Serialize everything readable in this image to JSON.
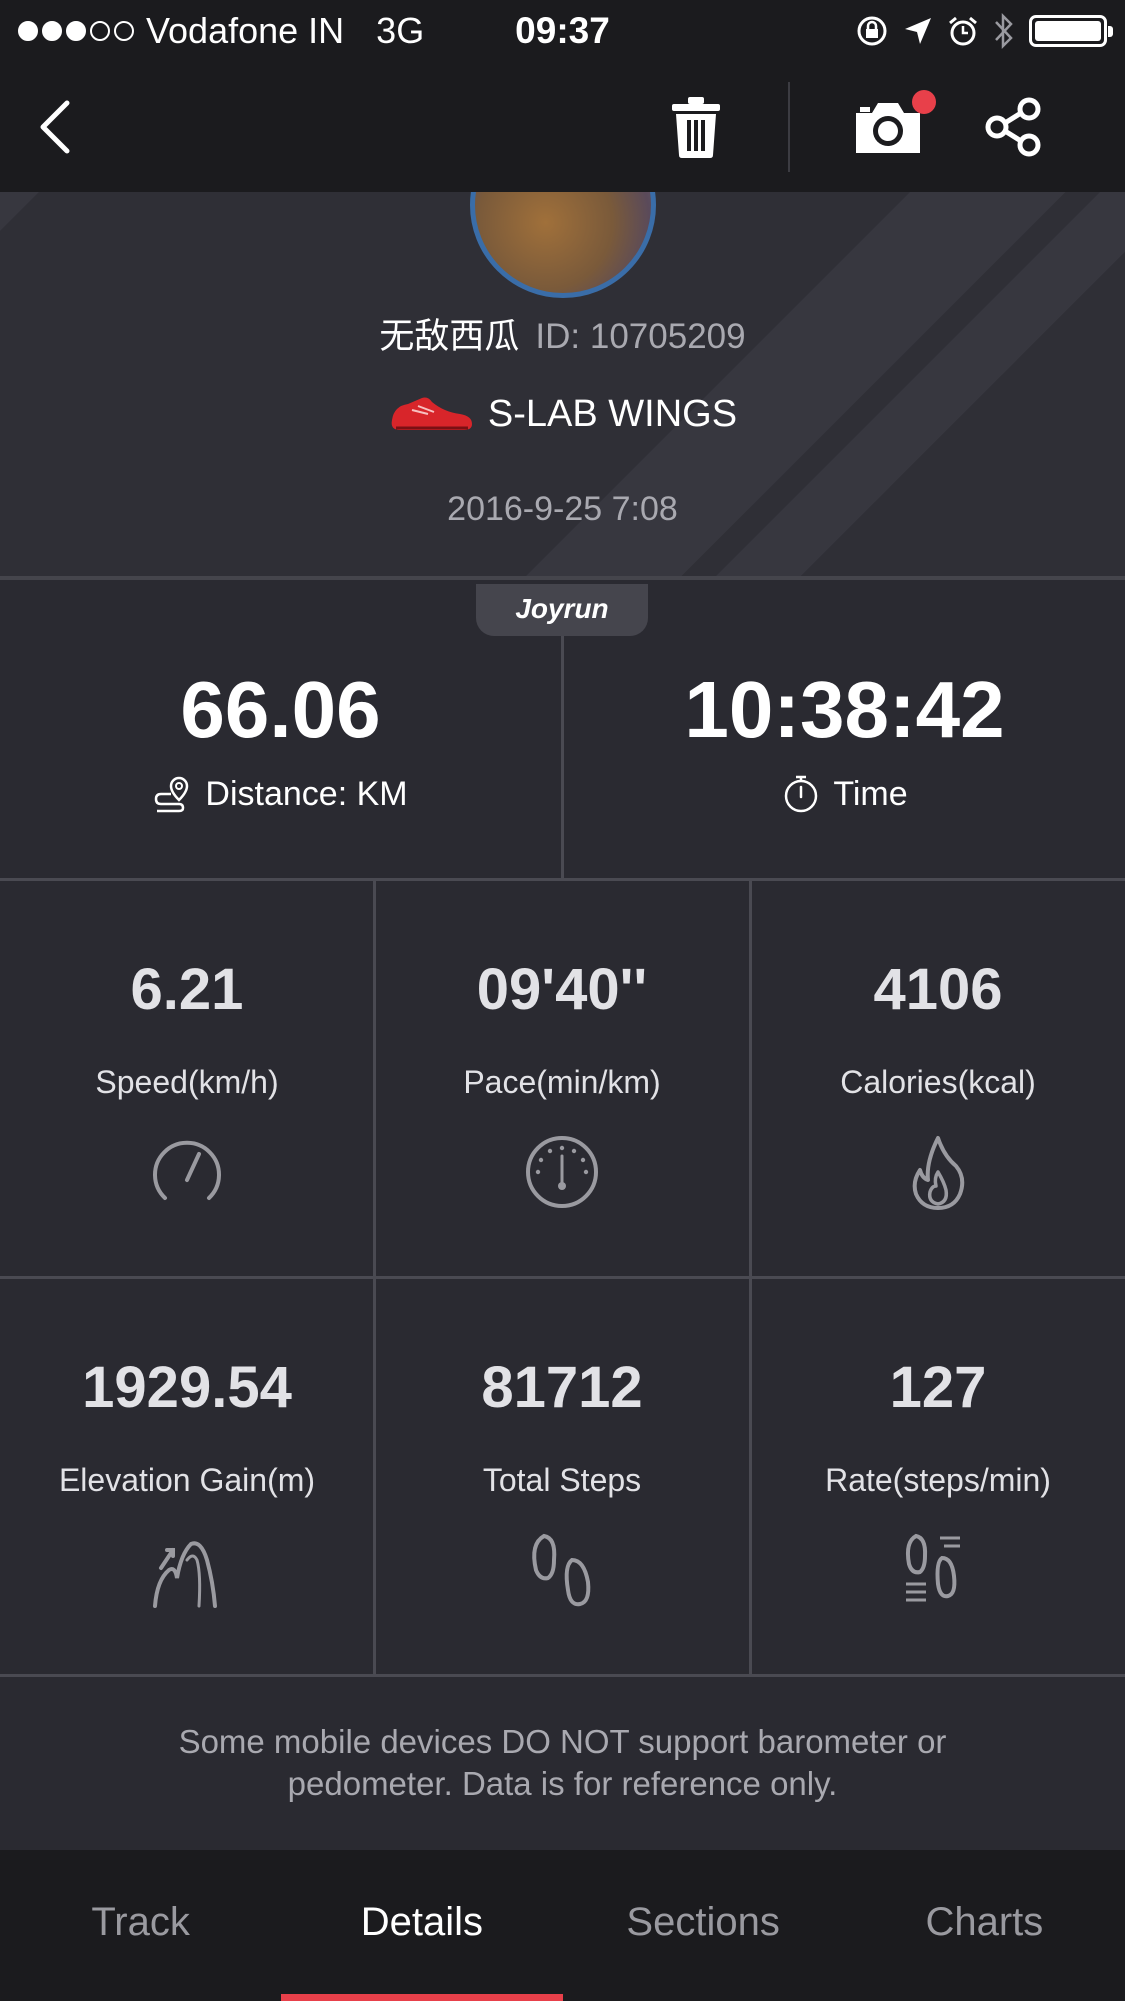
{
  "status_bar": {
    "carrier": "Vodafone IN",
    "network": "3G",
    "time": "09:37",
    "signal_bars": 3,
    "signal_total": 5,
    "battery_level": 1.0
  },
  "nav": {
    "back_icon": "chevron-left-icon",
    "delete_icon": "trash-icon",
    "camera_icon": "camera-icon",
    "share_icon": "share-icon",
    "camera_badge_color": "#e8404a"
  },
  "profile": {
    "name": "无敌西瓜",
    "id": "ID: 10705209",
    "shoe": "S-LAB WINGS",
    "date": "2016-9-25 7:08"
  },
  "brand": "Joyrun",
  "summary": {
    "distance": {
      "value": "66.06",
      "label": "Distance: KM"
    },
    "time": {
      "value": "10:38:42",
      "label": "Time"
    }
  },
  "stats": [
    {
      "value": "6.21",
      "label": "Speed(km/h)",
      "icon": "speedometer-icon"
    },
    {
      "value": "09'40''",
      "label": "Pace(min/km)",
      "icon": "pace-gauge-icon"
    },
    {
      "value": "4106",
      "label": "Calories(kcal)",
      "icon": "flame-icon"
    },
    {
      "value": "1929.54",
      "label": "Elevation Gain(m)",
      "icon": "elevation-icon"
    },
    {
      "value": "81712",
      "label": "Total Steps",
      "icon": "footprints-icon"
    },
    {
      "value": "127",
      "label": "Rate(steps/min)",
      "icon": "step-rate-icon"
    }
  ],
  "disclaimer": "Some mobile devices DO NOT support barometer or pedometer. Data is for reference only.",
  "tabs": [
    {
      "label": "Track",
      "active": false
    },
    {
      "label": "Details",
      "active": true
    },
    {
      "label": "Sections",
      "active": false
    },
    {
      "label": "Charts",
      "active": false
    }
  ],
  "colors": {
    "accent": "#e8404a",
    "background": "#2a2a31",
    "bar": "#1b1b1e",
    "avatar_ring": "#3a6da8"
  }
}
